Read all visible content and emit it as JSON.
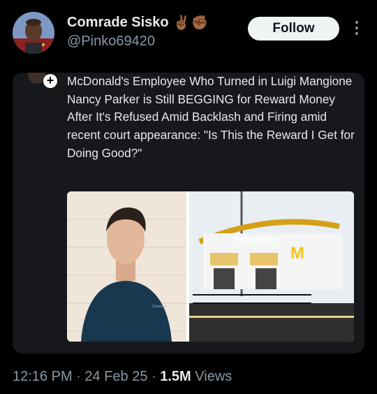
{
  "author": {
    "display_name": "Comrade Sisko",
    "emoji_badges": "✌🏾✊🏾",
    "handle": "@Pinko69420"
  },
  "follow_label": "Follow",
  "quoted_post": {
    "text": "McDonald's Employee Who Turned in Luigi Mangione Nancy Parker is Still BEGGING for Reward Money After It's Refused Amid Backlash and Firing amid recent court appearance: \"Is This the Reward I Get for Doing Good?\"",
    "plus_badge": "+",
    "image_sign_text": "McDonald's",
    "image_logo": "M",
    "shirt_brand": "Columbia"
  },
  "footer": {
    "time": "12:16 PM",
    "sep1": " · ",
    "date": "24 Feb 25",
    "sep2": " · ",
    "views_count": "1.5M",
    "views_label": " Views"
  },
  "colors": {
    "background": "#000000",
    "card": "#16181c",
    "follow_bg": "#eff3f4",
    "muted": "#8b98a5",
    "mcdonalds_yellow": "#f5c518"
  },
  "icons": [
    "profile-avatar",
    "plus-icon",
    "more-options-icon"
  ]
}
